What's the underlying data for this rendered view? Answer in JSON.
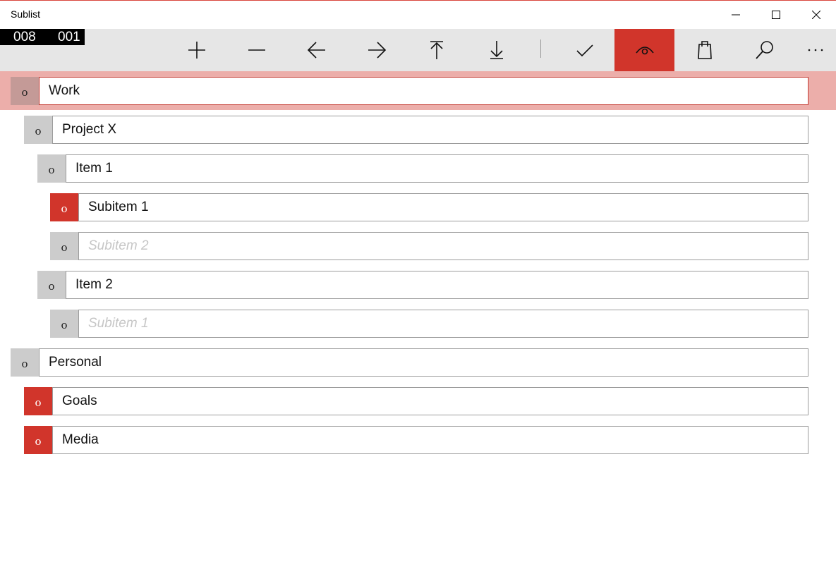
{
  "app": {
    "title": "Sublist"
  },
  "counters": {
    "left": "008",
    "right": "001"
  },
  "toolbar": {
    "buttons": [
      {
        "name": "add-button",
        "icon": "plus-icon"
      },
      {
        "name": "remove-button",
        "icon": "minus-icon"
      },
      {
        "name": "outdent-button",
        "icon": "arrow-left-icon"
      },
      {
        "name": "indent-button",
        "icon": "arrow-right-icon"
      },
      {
        "name": "move-up-button",
        "icon": "arrow-up-to-top-icon"
      },
      {
        "name": "move-down-button",
        "icon": "arrow-down-icon"
      },
      {
        "name": "complete-button",
        "icon": "checkmark-icon"
      },
      {
        "name": "view-button",
        "icon": "eye-icon",
        "active": true
      },
      {
        "name": "clipboard-button",
        "icon": "clipboard-icon"
      },
      {
        "name": "search-button",
        "icon": "search-icon"
      },
      {
        "name": "more-button",
        "icon": "more-icon"
      }
    ],
    "accent": "#d1352b"
  },
  "items": [
    {
      "label": "Work",
      "bullet": "o",
      "level": 0,
      "state": "selected"
    },
    {
      "label": "Project X",
      "bullet": "o",
      "level": 1,
      "state": "normal"
    },
    {
      "label": "Item 1",
      "bullet": "o",
      "level": 2,
      "state": "normal"
    },
    {
      "label": "Subitem 1",
      "bullet": "o",
      "level": 3,
      "state": "red"
    },
    {
      "label": "Subitem 2",
      "bullet": "o",
      "level": 3,
      "state": "placeholder"
    },
    {
      "label": "Item 2",
      "bullet": "o",
      "level": 2,
      "state": "normal"
    },
    {
      "label": "Subitem 1",
      "bullet": "o",
      "level": 3,
      "state": "placeholder"
    },
    {
      "label": "Personal",
      "bullet": "o",
      "level": 0,
      "state": "normal"
    },
    {
      "label": "Goals",
      "bullet": "o",
      "level": 1,
      "state": "red"
    },
    {
      "label": "Media",
      "bullet": "o",
      "level": 1,
      "state": "red"
    }
  ],
  "colors": {
    "accent": "#d1352b",
    "selection_band": "#ecaeaa",
    "bullet_gray": "#cccccc"
  }
}
